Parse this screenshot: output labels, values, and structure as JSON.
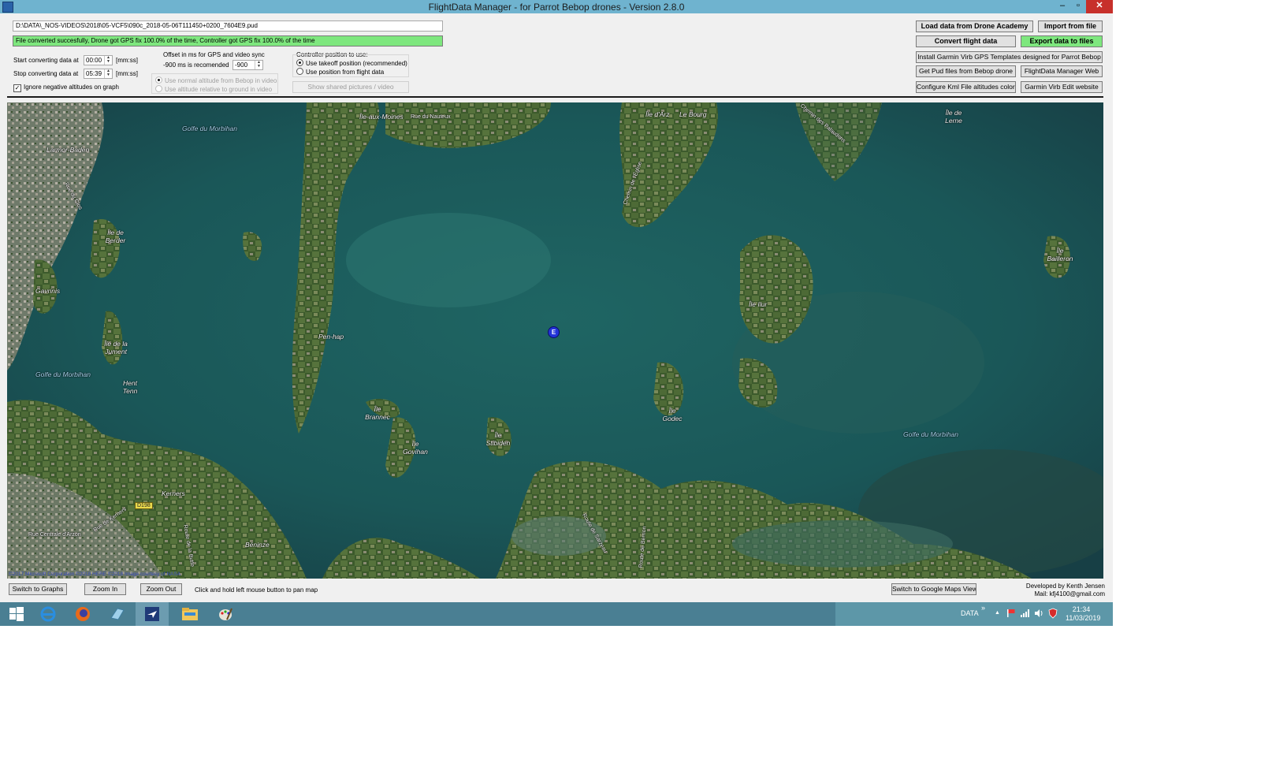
{
  "window": {
    "title": "FlightData Manager - for Parrot Bebop drones - Version 2.8.0",
    "minimize": "–",
    "maximize": "▫",
    "close": "✕"
  },
  "file": {
    "path": "D:\\DATA\\_NOS-VIDEOS\\2018\\05-VCF5\\090c_2018-05-06T111450+0200_7604E9.pud",
    "status": "File converted succesfully, Drone got GPS fix 100.0% of the time, Controller got GPS fix 100.0% of the time"
  },
  "convert": {
    "start_label": "Start converting data at",
    "start_value": "00:00",
    "stop_label": "Stop converting data at",
    "stop_value": "05:39",
    "unit": "[mm:ss]",
    "ignore_negative_label": "Ignore negative altitudes on graph",
    "ignore_negative_checked": "✓"
  },
  "offset": {
    "title": "Offset in ms for GPS and video sync",
    "recommend": "-900 ms is recomended",
    "value": "-900",
    "alt_normal": "Use normal altitude from Bebop in video",
    "alt_relative": "Use altitude relative to ground in video"
  },
  "controller": {
    "title": "Controller position to use:",
    "opt_takeoff": "Use takeoff position (recommended)",
    "opt_flight": "Use position from flight data",
    "show_shared": "Show shared pictures / video"
  },
  "buttons": {
    "load_academy": "Load data from Drone Academy",
    "import_file": "Import from file",
    "convert": "Convert flight data",
    "export": "Export data to files",
    "install_garmin": "Install Garmin Virb GPS Templates designed for Parrot Bebop",
    "get_pud": "Get Pud files from Bebop drone",
    "fdm_web": "FlightData Manager Web",
    "configure_kml": "Configure Kml File altitudes colors",
    "garmin_web": "Garmin Virb Edit website"
  },
  "map": {
    "marker": "E",
    "labels": [
      "Golfe du Morbihan",
      "Larmor-Baden",
      "Île-aux-Moines",
      "Rue du Nauteux",
      "Île d'Arz",
      "Le Bourg",
      "Île de Lerne",
      "Île de Berder",
      "Gavrinis",
      "Île de la Jument",
      "Golfe du Morbihan",
      "Hent Tenn",
      "Pen-hap",
      "Île Brannec",
      "Île Govihan",
      "Île Stibiden",
      "Île Godec",
      "Golfe du Morbihan",
      "Île Ilur",
      "Île Bailleron",
      "Kerners",
      "Béninze",
      "Rue Centrale d'Arzon",
      "Chemin de l'Église",
      "Route de Berrion",
      "Rue de Kerners",
      "Route de Sarzeau",
      "Route de la Butte",
      "Rue du Clos",
      "Chemin des Palaudons"
    ],
    "road_sign": "D198",
    "copyright": "©2017 Microsoft Corporation ©2018 HERE ©2018 Image courtesy of NASA"
  },
  "bottom": {
    "switch_graphs": "Switch to Graphs",
    "zoom_in": "Zoom In",
    "zoom_out": "Zoom Out",
    "pan_hint": "Click and hold left mouse button to pan map",
    "switch_google": "Switch to Google Maps View",
    "developer": "Developed by Kenth Jensen",
    "mail": "Mail: kfj4100@gmail.com"
  },
  "taskbar": {
    "apps": [
      "windows-start",
      "internet-explorer",
      "firefox",
      "device-manager",
      "flightdata-manager",
      "file-explorer",
      "paint"
    ],
    "data_label": "DATA",
    "expand": "»",
    "tray_up": "▲",
    "time": "21:34",
    "date": "11/03/2019"
  },
  "colors": {
    "titlebar": "#6fb3cf",
    "status_green": "#7ee77e",
    "close_red": "#c7302b",
    "sea": "#1b5a5a"
  }
}
